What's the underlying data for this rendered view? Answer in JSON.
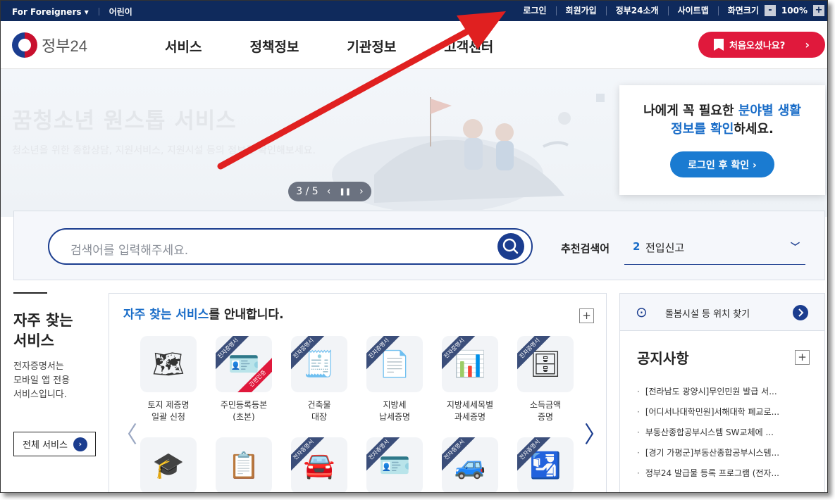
{
  "util": {
    "foreigners": "For Foreigners",
    "kids": "어린이",
    "login": "로그인",
    "join": "회원가입",
    "about": "정부24소개",
    "sitemap": "사이트맵",
    "zoom_label": "화면크기",
    "zoom_minus": "-",
    "zoom_value": "100%",
    "zoom_plus": "+"
  },
  "header": {
    "logo_text": "정부24",
    "nav": [
      "서비스",
      "정책정보",
      "기관정보",
      "고객센터"
    ],
    "first_visit": "처음오셨나요?"
  },
  "hero": {
    "title": "꿈청소년 원스톱 서비스",
    "subtitle": "청소년을 위한 종합상담, 지원서비스, 지원시설 등의 정보를 확인해보세요.",
    "pager": "3 / 5"
  },
  "info_card": {
    "q_part1": "나에게 꼭 필요한 ",
    "q_hl1": "분야별 생활",
    "q_hl2": "정보를 확인",
    "q_part2": "하세요.",
    "button": "로그인 후 확인 ›"
  },
  "search": {
    "placeholder": "검색어를 입력해주세요.",
    "rec_label": "추천검색어",
    "rec_num": "2",
    "rec_value": "전입신고"
  },
  "left": {
    "title_line1": "자주 찾는",
    "title_line2": "서비스",
    "desc_line1": "전자증명서는",
    "desc_line2": "모바일 앱 전용",
    "desc_line3": "서비스입니다.",
    "all_button": "전체 서비스"
  },
  "services": {
    "head_hl": "자주 찾는 서비스",
    "head_rest": "를 안내합니다.",
    "ribbon": "전자증명서",
    "ribbon_easy": "간편인증",
    "tiles": [
      {
        "l1": "토지 제증명",
        "l2": "일괄 신청",
        "icon": "map-icon",
        "glyph": "🗺"
      },
      {
        "l1": "주민등록등본",
        "l2": "(초본)",
        "icon": "id-card-icon",
        "glyph": "🪪"
      },
      {
        "l1": "건축물",
        "l2": "대장",
        "icon": "document-search-icon",
        "glyph": "🧾"
      },
      {
        "l1": "지방세",
        "l2": "납세증명",
        "icon": "document-icon",
        "glyph": "📄"
      },
      {
        "l1": "지방세세목별",
        "l2": "과세증명",
        "icon": "chart-board-icon",
        "glyph": "📊"
      },
      {
        "l1": "소득금액",
        "l2": "증명",
        "icon": "coins-icon",
        "glyph": "🗄"
      }
    ],
    "row2_icons": [
      {
        "icon": "graduation-cap-icon",
        "glyph": "🎓"
      },
      {
        "icon": "checklist-icon",
        "glyph": "📋"
      },
      {
        "icon": "car-document-icon",
        "glyph": "🚘"
      },
      {
        "icon": "license-card-icon",
        "glyph": "🪪"
      },
      {
        "icon": "vehicle-register-icon",
        "glyph": "🚙"
      },
      {
        "icon": "passport-icon",
        "glyph": "🛂"
      }
    ]
  },
  "right": {
    "nearby": "돌봄시설 등 위치 찾기",
    "notice_title": "공지사항",
    "notices": [
      "[전라남도 광양시]무인민원 발급 서...",
      "[어디서나대학민원]서해대학 폐교로...",
      "부동산종합공부시스템 SW교체에 ...",
      "[경기 가평군]부동산종합공부시스템...",
      "정부24 발급물 등록 프로그램 (전자..."
    ]
  },
  "colors": {
    "navy": "#0f2a5c",
    "brand_blue": "#1b3d8f",
    "highlight": "#1a6dc8",
    "accent_red": "#e0193c",
    "annotation_red": "#e02020"
  }
}
